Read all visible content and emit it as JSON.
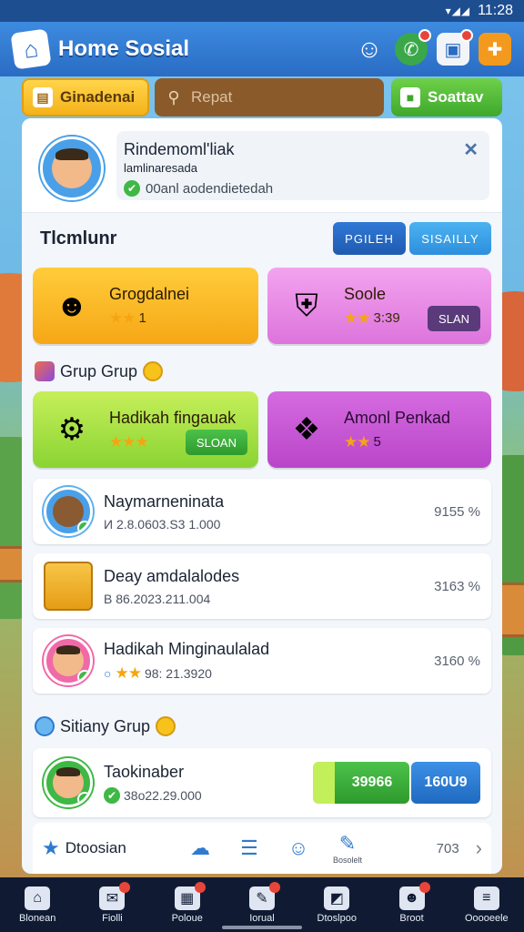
{
  "status_bar": {
    "time": "11:28",
    "signal": "▾◢◢"
  },
  "header": {
    "title": "Home Sosial"
  },
  "tabs": [
    {
      "label": "Ginadenai"
    },
    {
      "label": "Repat",
      "placeholder": "Repat"
    },
    {
      "label": "Soattav"
    }
  ],
  "profile": {
    "name": "Rindemoml'liak",
    "subtitle": "lamlinaresada",
    "status": "00anl aodendietedah"
  },
  "section": {
    "title": "Tlcmlunr",
    "pill_left": "PGILEH",
    "pill_right": "SISAILLY"
  },
  "cards": [
    {
      "title": "Grogdalnei",
      "meta": "1",
      "stars": "★★"
    },
    {
      "title": "Soole",
      "meta": "3:39",
      "stars": "★★",
      "button": "SLAN"
    },
    {
      "title": "Hadikah fingauak",
      "meta": "",
      "stars": "★★★",
      "button": "SLOAN"
    },
    {
      "title": "Amonl Penkad",
      "meta": "5",
      "stars": "★★"
    }
  ],
  "groups": [
    {
      "title": "Grup Grup"
    },
    {
      "title": "Sitiany Grup"
    }
  ],
  "rows": [
    {
      "title": "Naymarneninata",
      "sub": "И 2.8.0603.S3 1.000",
      "value": "9155 %"
    },
    {
      "title": "Deay amdalalodes",
      "sub": "B 86.2023.211.004",
      "value": "3163 %"
    },
    {
      "title": "Hadikah Minginaulalad",
      "sub": "98: 21.3920",
      "value": "3160 %"
    }
  ],
  "wide_row": {
    "title": "Taokinaber",
    "sub": "38o22.29.000",
    "btn_green": "39966",
    "btn_blue": "160U9"
  },
  "strip": {
    "label": "Dtoosian",
    "caption": "Bosolelt",
    "number": "703"
  },
  "bottom_nav": [
    {
      "label": "Blonean"
    },
    {
      "label": "Fiolli"
    },
    {
      "label": "Poloue"
    },
    {
      "label": "Iorual"
    },
    {
      "label": "Dtoslpoo"
    },
    {
      "label": "Broot"
    },
    {
      "label": "Ooooeele"
    }
  ]
}
